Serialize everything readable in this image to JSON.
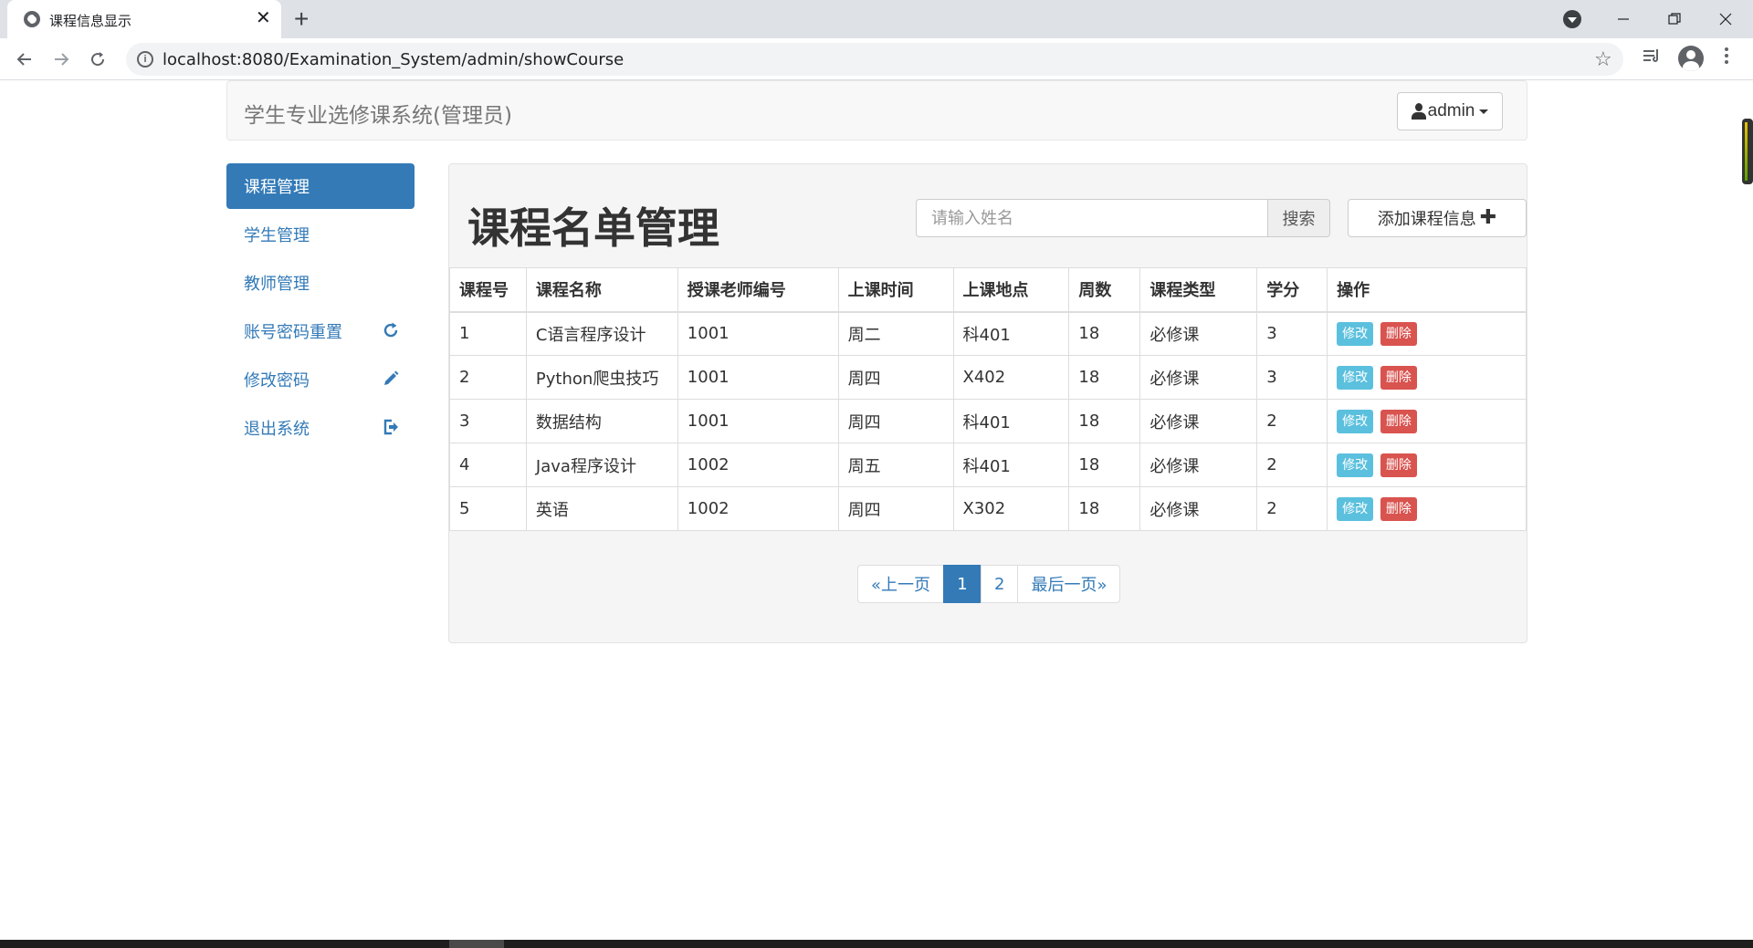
{
  "browser": {
    "tab_title": "课程信息显示",
    "url": "localhost:8080/Examination_System/admin/showCourse"
  },
  "navbar": {
    "brand": "学生专业选修课系统(管理员)",
    "user": "admin"
  },
  "sidebar": {
    "items": [
      {
        "label": "课程管理",
        "active": true,
        "icon": ""
      },
      {
        "label": "学生管理",
        "active": false,
        "icon": ""
      },
      {
        "label": "教师管理",
        "active": false,
        "icon": ""
      },
      {
        "label": "账号密码重置",
        "active": false,
        "icon": "refresh-icon"
      },
      {
        "label": "修改密码",
        "active": false,
        "icon": "pencil-icon"
      },
      {
        "label": "退出系统",
        "active": false,
        "icon": "logout-icon"
      }
    ]
  },
  "main": {
    "title": "课程名单管理",
    "search": {
      "placeholder": "请输入姓名",
      "button": "搜索"
    },
    "add_button": "添加课程信息",
    "table": {
      "headers": [
        "课程号",
        "课程名称",
        "授课老师编号",
        "上课时间",
        "上课地点",
        "周数",
        "课程类型",
        "学分",
        "操作"
      ],
      "rows": [
        [
          "1",
          "C语言程序设计",
          "1001",
          "周二",
          "科401",
          "18",
          "必修课",
          "3"
        ],
        [
          "2",
          "Python爬虫技巧",
          "1001",
          "周四",
          "X402",
          "18",
          "必修课",
          "3"
        ],
        [
          "3",
          "数据结构",
          "1001",
          "周四",
          "科401",
          "18",
          "必修课",
          "2"
        ],
        [
          "4",
          "Java程序设计",
          "1002",
          "周五",
          "科401",
          "18",
          "必修课",
          "2"
        ],
        [
          "5",
          "英语",
          "1002",
          "周四",
          "X302",
          "18",
          "必修课",
          "2"
        ]
      ],
      "edit_label": "修改",
      "delete_label": "删除"
    },
    "pagination": {
      "prev": "«上一页",
      "pages": [
        "1",
        "2"
      ],
      "active_page": "1",
      "last": "最后一页»"
    }
  },
  "colors": {
    "primary": "#337ab7",
    "info": "#5bc0de",
    "danger": "#d9534f"
  }
}
